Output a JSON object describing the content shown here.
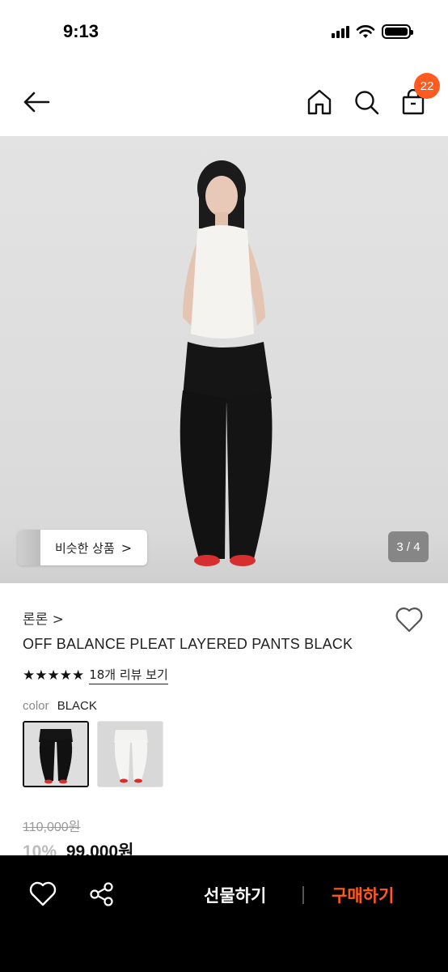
{
  "status": {
    "time": "9:13"
  },
  "nav": {
    "cart_count": "22"
  },
  "hero": {
    "similar_label": "비슷한 상품",
    "page_indicator": "3 / 4",
    "similar_chevron": ">"
  },
  "product": {
    "brand": "론론 >",
    "name": "OFF BALANCE PLEAT LAYERED PANTS BLACK",
    "stars": "★★★★★",
    "review_link": "18개 리뷰 보기",
    "color_label": "color",
    "color_value": "BLACK",
    "price_original": "110,000원",
    "discount": "10%",
    "price_final": "99,000원"
  },
  "bottom_bar": {
    "gift_label": "선물하기",
    "buy_label": "구매하기"
  },
  "colors": {
    "accent": "#ff5a1f",
    "bottom_bar": "#000000"
  }
}
